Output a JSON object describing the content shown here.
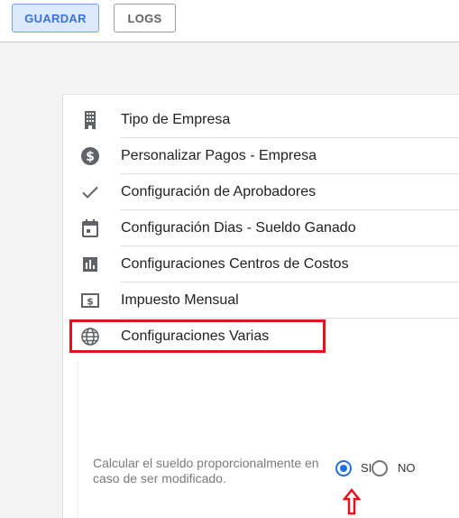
{
  "toolbar": {
    "save_label": "GUARDAR",
    "logs_label": "LOGS"
  },
  "menu": {
    "items": [
      {
        "label": "Tipo de Empresa",
        "icon": "building-icon"
      },
      {
        "label": "Personalizar Pagos - Empresa",
        "icon": "dollar-circle-icon"
      },
      {
        "label": "Configuración de Aprobadores",
        "icon": "checkmark-icon"
      },
      {
        "label": "Configuración Dias - Sueldo Ganado",
        "icon": "calendar-icon"
      },
      {
        "label": "Configuraciones Centros de Costos",
        "icon": "bar-chart-icon"
      },
      {
        "label": "Impuesto Mensual",
        "icon": "money-bill-icon"
      },
      {
        "label": "Configuraciones Varias",
        "icon": "globe-icon"
      }
    ]
  },
  "settings": {
    "option_label": "Calcular el sueldo proporcionalmente en caso de ser modificado.",
    "radio_yes": "SI",
    "radio_no": "NO",
    "selected": "SI"
  },
  "colors": {
    "accent": "#1e6fe0",
    "highlight": "#e0141d",
    "save_bg": "#dce8fb"
  }
}
